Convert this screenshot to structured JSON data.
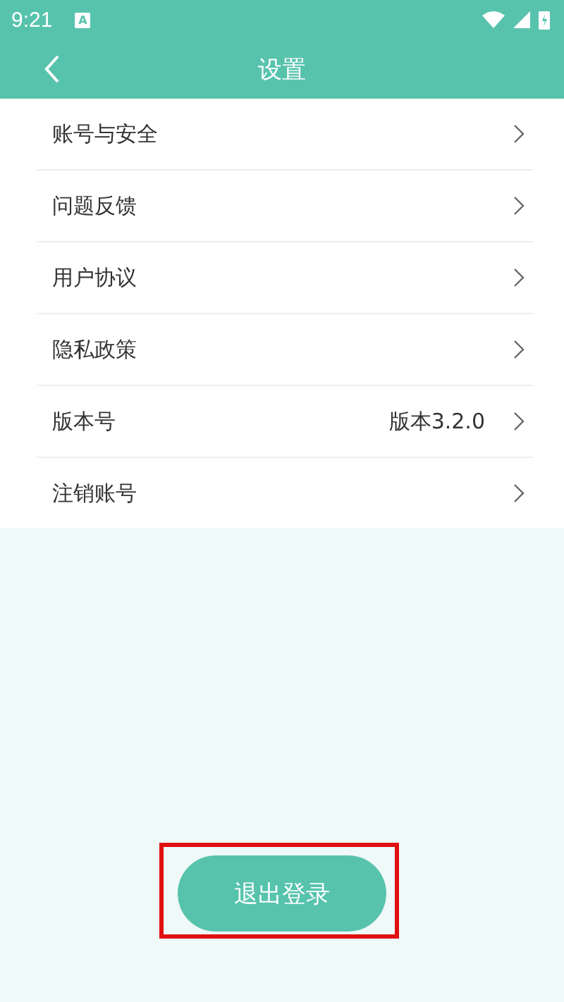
{
  "status_bar": {
    "time": "9:21",
    "notification": "A"
  },
  "header": {
    "title": "设置"
  },
  "settings": [
    {
      "label": "账号与安全"
    },
    {
      "label": "问题反馈"
    },
    {
      "label": "用户协议"
    },
    {
      "label": "隐私政策"
    },
    {
      "label": "版本号",
      "value": "版本3.2.0"
    },
    {
      "label": "注销账号"
    }
  ],
  "logout_button": {
    "label": "退出登录",
    "highlighted": true
  }
}
